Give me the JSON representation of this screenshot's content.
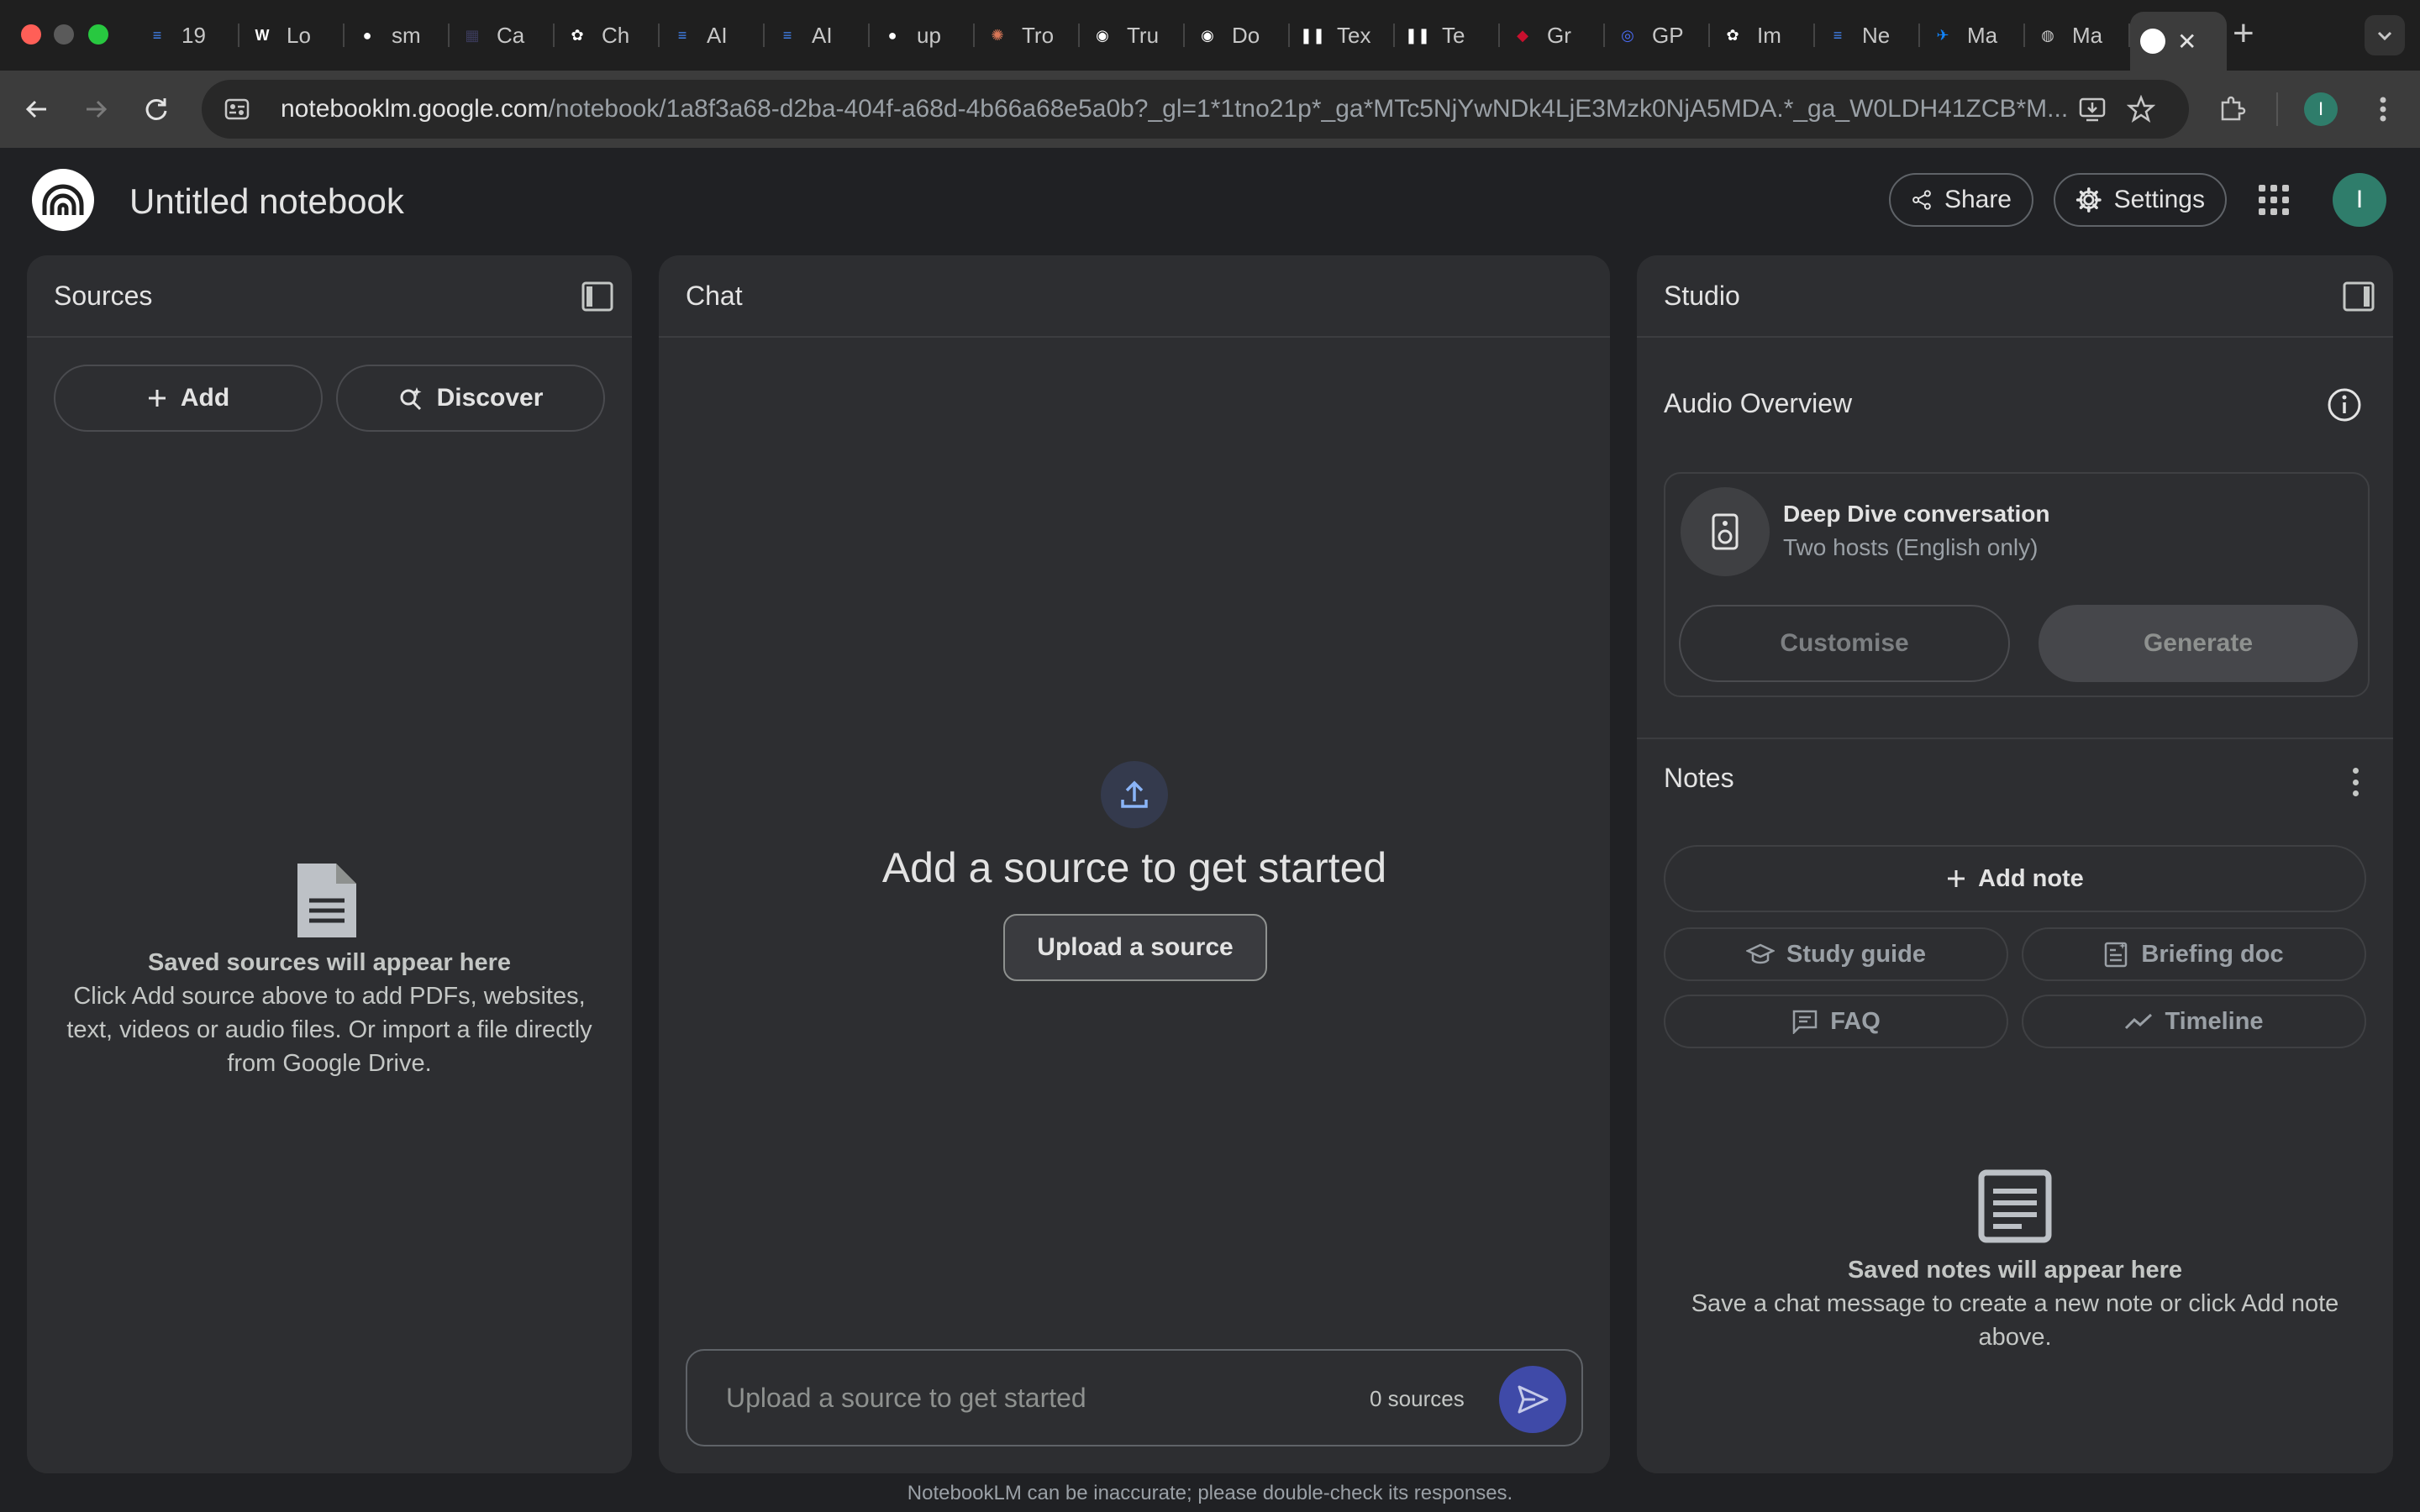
{
  "browser": {
    "tabs": [
      {
        "label": "19",
        "icon": "docs-icon",
        "color": "#4285f4",
        "glyph": "≡"
      },
      {
        "label": "Lo",
        "icon": "wordpress-icon",
        "color": "#ffffff",
        "glyph": "W"
      },
      {
        "label": "sm",
        "icon": "github-icon",
        "color": "#ffffff",
        "glyph": "●"
      },
      {
        "label": "Ca",
        "icon": "calendar-icon",
        "color": "#3b3b5b",
        "glyph": "▦"
      },
      {
        "label": "Ch",
        "icon": "openai-icon",
        "color": "#ffffff",
        "glyph": "✿"
      },
      {
        "label": "AI",
        "icon": "docs-icon",
        "color": "#4285f4",
        "glyph": "≡"
      },
      {
        "label": "AI",
        "icon": "docs-icon",
        "color": "#4285f4",
        "glyph": "≡"
      },
      {
        "label": "up",
        "icon": "github-icon",
        "color": "#ffffff",
        "glyph": "●"
      },
      {
        "label": "Tro",
        "icon": "claude-icon",
        "color": "#d97757",
        "glyph": "✺"
      },
      {
        "label": "Tru",
        "icon": "notebooklm-icon",
        "color": "#ffffff",
        "glyph": "◉"
      },
      {
        "label": "Do",
        "icon": "notebooklm-icon",
        "color": "#ffffff",
        "glyph": "◉"
      },
      {
        "label": "Tex",
        "icon": "pause-icon",
        "color": "#ffffff",
        "glyph": "❚❚"
      },
      {
        "label": "Te",
        "icon": "pause-icon",
        "color": "#ffffff",
        "glyph": "❚❚"
      },
      {
        "label": "Gr",
        "icon": "maryland-icon",
        "color": "#c8102e",
        "glyph": "◆"
      },
      {
        "label": "GP",
        "icon": "gpt-icon",
        "color": "#4a6cf7",
        "glyph": "◎"
      },
      {
        "label": "Im",
        "icon": "openai-icon",
        "color": "#ffffff",
        "glyph": "✿"
      },
      {
        "label": "Ne",
        "icon": "docs-icon",
        "color": "#4285f4",
        "glyph": "≡"
      },
      {
        "label": "Ma",
        "icon": "bluesky-icon",
        "color": "#1185fe",
        "glyph": "✈"
      },
      {
        "label": "Ma",
        "icon": "globe-icon",
        "color": "#c7c7c7",
        "glyph": "◍"
      }
    ],
    "active_tab": {
      "icon": "notebooklm-icon",
      "close": "✕"
    },
    "new_tab": "+",
    "url_host": "notebooklm.google.com",
    "url_path": "/notebook/1a8f3a68-d2ba-404f-a68d-4b66a68e5a0b?_gl=1*1tno21p*_ga*MTc5NjYwNDk4LjE3Mzk0NjA5MDA.*_ga_W0LDH41ZCB*M...",
    "profile_initial": "I"
  },
  "app": {
    "title": "Untitled notebook",
    "share_label": "Share",
    "settings_label": "Settings",
    "avatar_initial": "I"
  },
  "sources": {
    "title": "Sources",
    "add_label": "Add",
    "discover_label": "Discover",
    "empty_title": "Saved sources will appear here",
    "empty_desc": "Click Add source above to add PDFs, websites, text, videos or audio files. Or import a file directly from Google Drive."
  },
  "chat": {
    "title": "Chat",
    "headline": "Add a source to get started",
    "upload_label": "Upload a source",
    "input_placeholder": "Upload a source to get started",
    "source_count": "0 sources"
  },
  "studio": {
    "title": "Studio",
    "audio_title": "Audio Overview",
    "card_title": "Deep Dive conversation",
    "card_sub": "Two hosts (English only)",
    "customise_label": "Customise",
    "generate_label": "Generate",
    "notes_title": "Notes",
    "add_note_label": "Add note",
    "study_guide_label": "Study guide",
    "briefing_doc_label": "Briefing doc",
    "faq_label": "FAQ",
    "timeline_label": "Timeline",
    "notes_empty_title": "Saved notes will appear here",
    "notes_empty_desc": "Save a chat message to create a new note or click Add note above."
  },
  "footer": {
    "disclaimer": "NotebookLM can be inaccurate; please double-check its responses."
  }
}
